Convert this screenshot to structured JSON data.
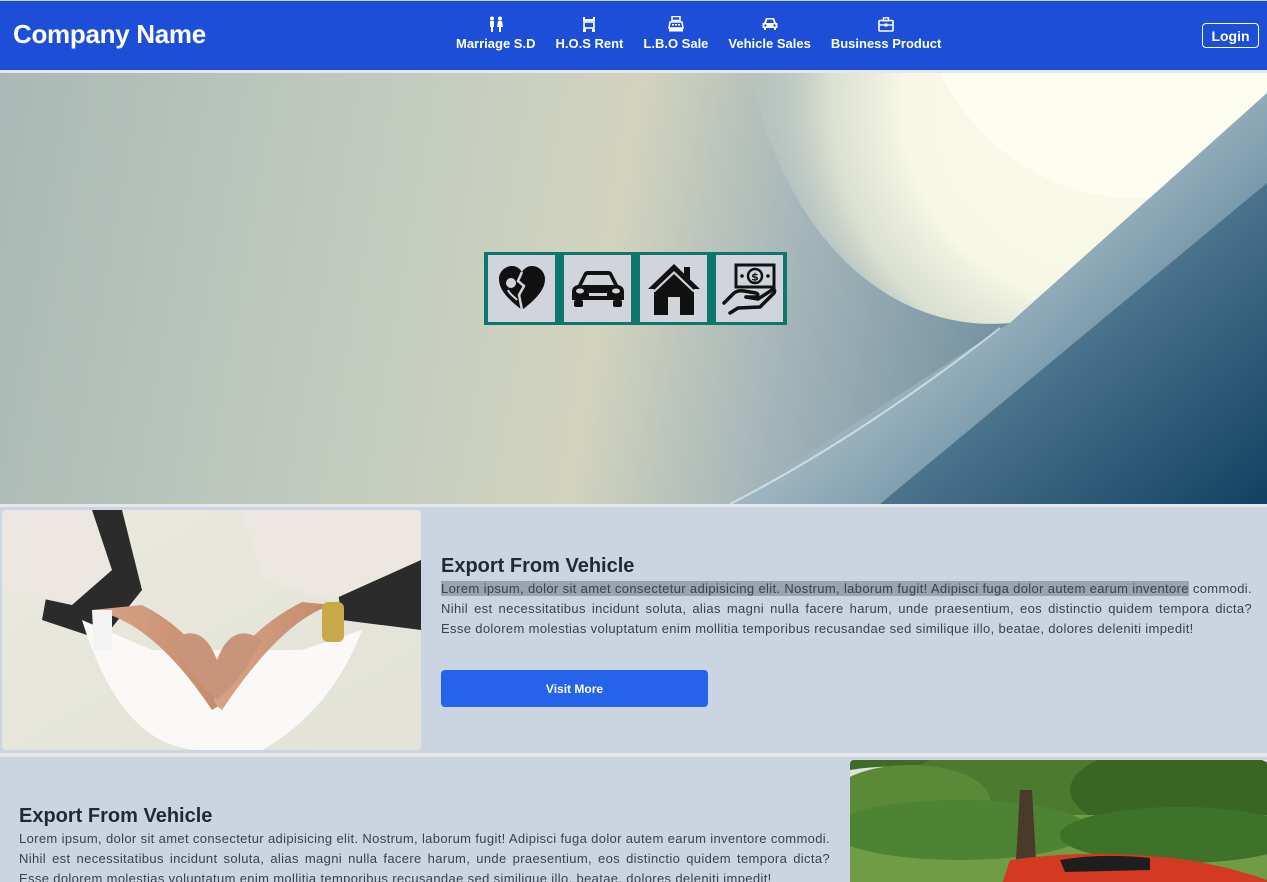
{
  "brand": {
    "name": "Company Name"
  },
  "nav": {
    "items": [
      {
        "label": "Marriage S.D",
        "icon": "couple-icon"
      },
      {
        "label": "H.O.S Rent",
        "icon": "signboard-icon"
      },
      {
        "label": "L.B.O Sale",
        "icon": "cash-register-icon"
      },
      {
        "label": "Vehicle Sales",
        "icon": "car-icon"
      },
      {
        "label": "Business Product",
        "icon": "briefcase-icon"
      }
    ],
    "login_label": "Login"
  },
  "hero": {
    "tiles": [
      "broken-heart-kiss-icon",
      "car-icon",
      "house-icon",
      "money-hand-icon"
    ]
  },
  "sections": [
    {
      "title": "Export From Vehicle",
      "text_highlight": "Lorem ipsum, dolor sit amet consectetur adipisicing elit. Nostrum, laborum fugit! Adipisci fuga dolor autem earum inventore",
      "text_rest": " commodi. Nihil est necessitatibus incidunt soluta, alias magni nulla facere harum, unde praesentium, eos distinctio quidem tempora dicta? Esse dolorem molestias voluptatum enim mollitia temporibus recusandae sed similique illo, beatae, dolores deleniti impedit!",
      "button": "Visit More"
    },
    {
      "title": "Export From Vehicle",
      "text": "Lorem ipsum, dolor sit amet consectetur adipisicing elit. Nostrum, laborum fugit! Adipisci fuga dolor autem earum inventore commodi. Nihil est necessitatibus incidunt soluta, alias magni nulla facere harum, unde praesentium, eos distinctio quidem tempora dicta? Esse dolorem molestias voluptatum enim mollitia temporibus recusandae sed similique illo, beatae, dolores deleniti impedit!"
    }
  ],
  "colors": {
    "navbar": "#1d4ed8",
    "section_bg": "#cbd5e1",
    "tile_border": "#0f766e",
    "button": "#2563eb"
  }
}
